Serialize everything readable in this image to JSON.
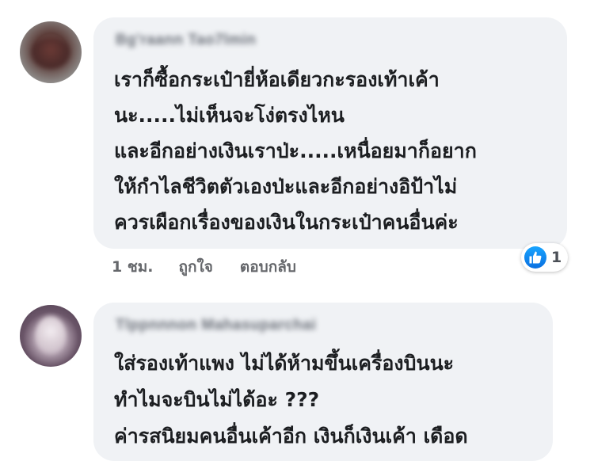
{
  "comments": [
    {
      "author": "Bg'raann Tao7lmin",
      "lines": [
        "เราก็ซื้อกระเป๋ายี่ห้อเดียวกะรองเท้าเค้า",
        "นะ.....ไม่เห็นจะโง่ตรงไหน",
        "และอีกอย่างเงินเราป่ะ.....เหนื่อยมาก็อยาก",
        "ให้กำไลชีวิตตัวเองป่ะและอีกอย่างอิป้าไม่",
        "ควรเผือกเรื่องของเงินในกระเป๋าคนอื่นค่ะ"
      ],
      "time": "1 ชม.",
      "like_label": "ถูกใจ",
      "reply_label": "ตอบกลับ",
      "reaction": {
        "icon": "thumbs-up-icon",
        "count": "1",
        "color": "#1877f2"
      }
    },
    {
      "author": "Tlppnnnon Mahasuparchai",
      "lines": [
        "ใส่รองเท้าแพง ไม่ได้ห้ามขึ้นเครื่องบินนะ",
        "ทำไมจะบินไม่ได้อะ ???",
        "ค่ารสนิยมคนอื่นเค้าอีก เงินก็เงินเค้า เดือด"
      ]
    }
  ],
  "colors": {
    "bubble": "#f0f2f5",
    "text": "#1c1e21",
    "meta": "#65676b"
  }
}
